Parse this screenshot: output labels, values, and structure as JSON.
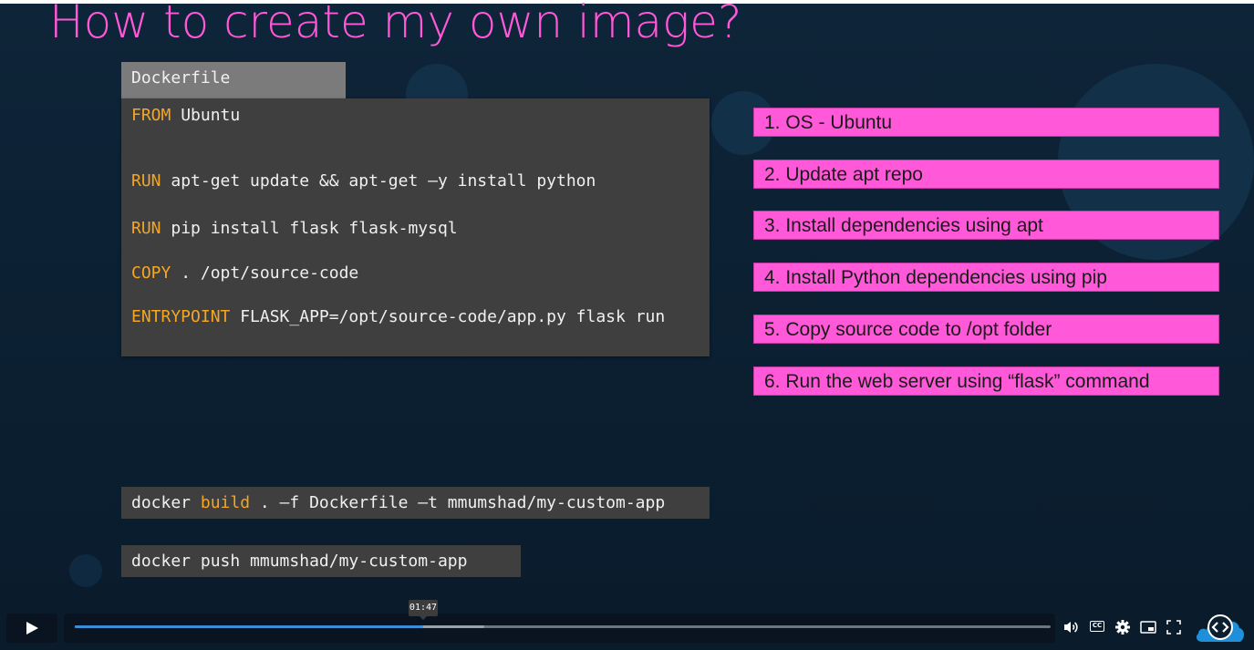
{
  "slide": {
    "title": "How to create my own image?",
    "dockerfile": {
      "tab_label": "Dockerfile",
      "lines": [
        {
          "keyword": "FROM",
          "rest": " Ubuntu"
        },
        {
          "keyword": "RUN",
          "rest": " apt-get update && apt-get –y install python"
        },
        {
          "keyword": "RUN",
          "rest": " pip install flask flask-mysql"
        },
        {
          "keyword": "COPY",
          "rest": " . /opt/source-code"
        },
        {
          "keyword": "ENTRYPOINT",
          "rest": " FLASK_APP=/opt/source-code/app.py flask run"
        }
      ]
    },
    "steps": [
      "1. OS - Ubuntu",
      "2. Update apt repo",
      "3. Install dependencies using apt",
      "4. Install Python dependencies using pip",
      "5. Copy source code to /opt folder",
      "6. Run the web server using “flask” command"
    ],
    "build_command": {
      "prefix": "docker ",
      "keyword": "build",
      "rest": " . –f Dockerfile –t mmumshad/my-custom-app"
    },
    "push_command": "docker push mmumshad/my-custom-app",
    "colors": {
      "accent_pink": "#ff58d8",
      "keyword_orange": "#f5a623",
      "code_bg": "#3f3f3f"
    }
  },
  "player": {
    "current_time_tooltip": "01:47",
    "progress_fraction": 0.357,
    "buffered_fraction": 0.42,
    "controls": [
      "play-icon",
      "volume-icon",
      "captions-icon",
      "settings-icon",
      "picture-in-picture-icon",
      "fullscreen-icon"
    ],
    "captions_label": "CC",
    "colors": {
      "progress": "#3b8fd6",
      "logo": "#1e8fd8"
    }
  }
}
